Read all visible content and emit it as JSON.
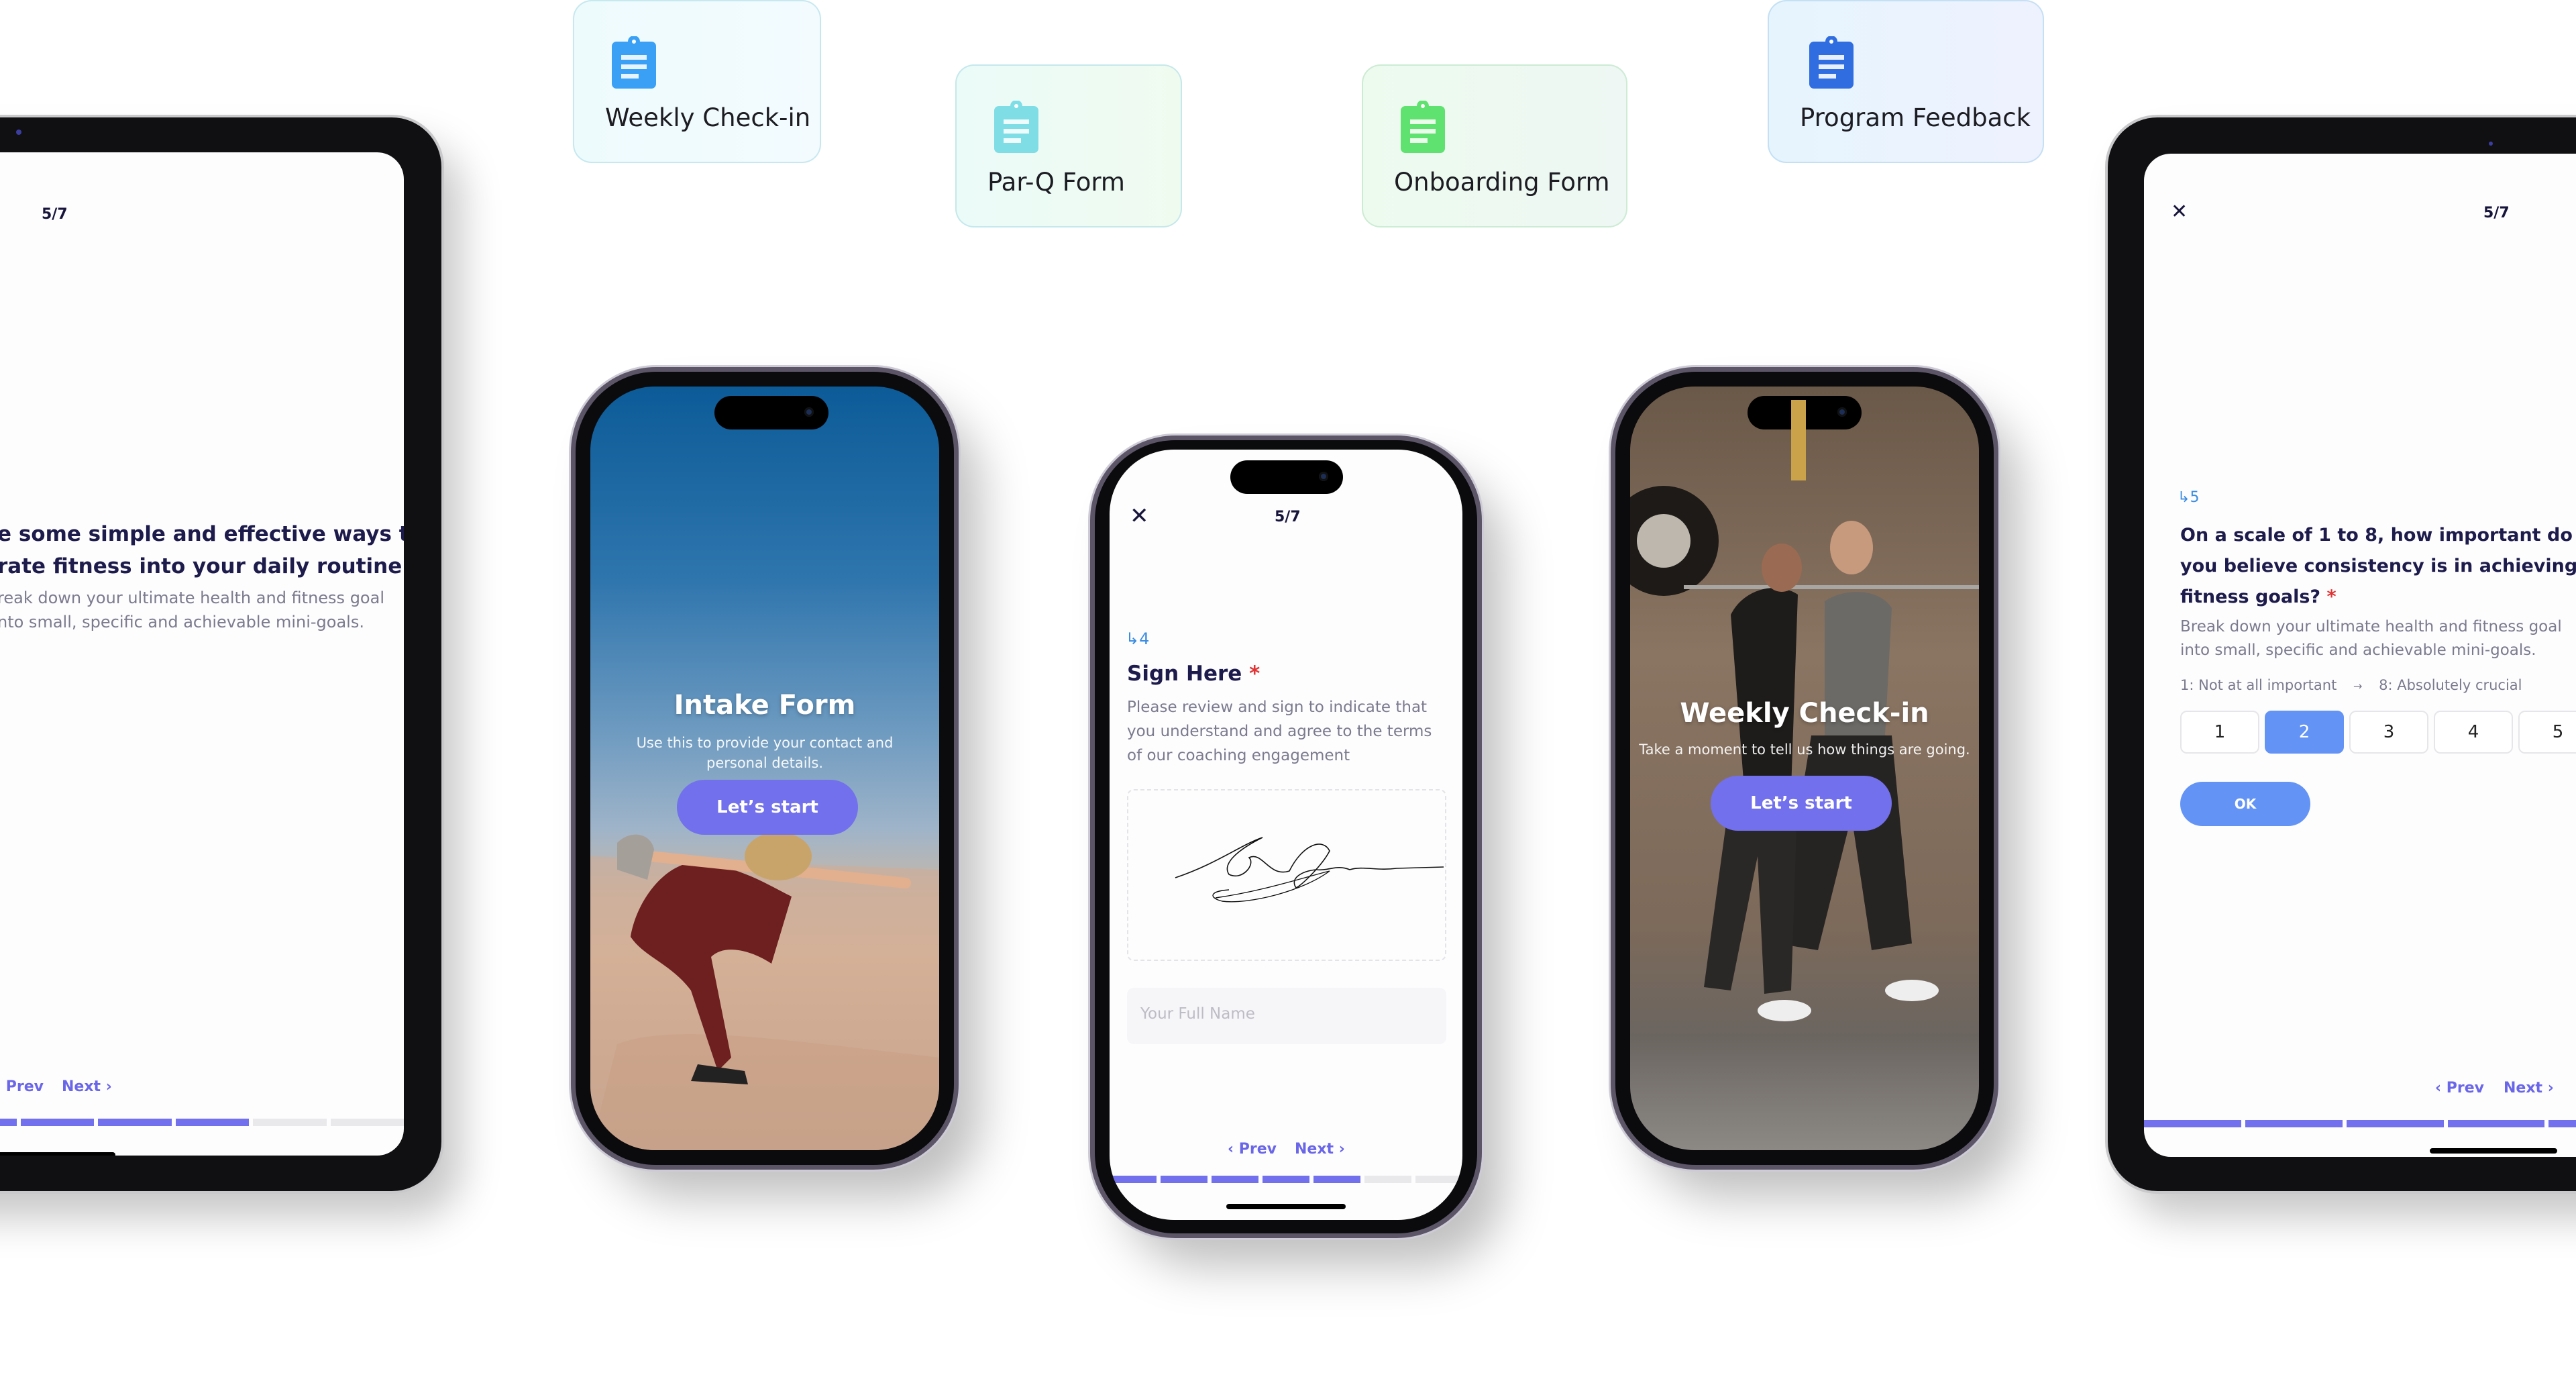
{
  "form_cards": [
    {
      "label": "Weekly Check-in",
      "icon": "clipboard-icon",
      "icon_color": "#3aa0f5"
    },
    {
      "label": "Par-Q Form",
      "icon": "clipboard-icon",
      "icon_color": "#7fdde6"
    },
    {
      "label": "Onboarding Form",
      "icon": "clipboard-icon",
      "icon_color": "#5fe26f"
    },
    {
      "label": "Program Feedback",
      "icon": "clipboard-icon",
      "icon_color": "#2f6de0"
    }
  ],
  "left_tablet": {
    "counter": "5/7",
    "question_title_line1": "e some simple and effective ways to",
    "question_title_line2": "rate fitness into your daily routine",
    "question_desc_line1": "reak down your ultimate health and fitness goal",
    "question_desc_line2": "nto small, specific and achievable mini-goals.",
    "prev_label": "Prev",
    "next_label": "Next",
    "progress": {
      "completed": 5,
      "total": 7
    }
  },
  "intake_phone": {
    "title": "Intake Form",
    "subtitle": "Use this to provide your contact and personal details.",
    "cta_label": "Let’s start"
  },
  "sign_phone": {
    "counter": "5/7",
    "question_number": "4",
    "question_title": "Sign Here",
    "required_mark": "*",
    "question_desc": "Please review and sign to indicate that you understand and agree to the terms of our coaching engagement",
    "name_placeholder": "Your Full Name",
    "prev_label": "Prev",
    "next_label": "Next",
    "progress": {
      "completed": 5,
      "total": 7
    }
  },
  "checkin_phone": {
    "title": "Weekly Check-in",
    "subtitle": "Take a moment to tell us how things are going.",
    "cta_label": "Let’s start"
  },
  "right_tablet": {
    "counter": "5/7",
    "question_number": "5",
    "question_title": "On a scale of 1 to 8, how important do you believe consistency is in achieving fitness goals?",
    "required_mark": "*",
    "question_desc": "Break down your ultimate health and fitness goal into small, specific and achievable mini-goals.",
    "scale_min_label": "1: Not at all important",
    "scale_arrow": "→",
    "scale_max_label": "8: Absolutely crucial",
    "scale_options": [
      "1",
      "2",
      "3",
      "4",
      "5"
    ],
    "selected_value": "2",
    "ok_label": "OK",
    "prev_label": "Prev",
    "next_label": "Next",
    "progress": {
      "completed": 5,
      "total": 7
    }
  },
  "colors": {
    "accent": "#7270ec",
    "selected_option": "#6393f5",
    "required": "#e03434",
    "question_number": "#3a8ce0"
  }
}
